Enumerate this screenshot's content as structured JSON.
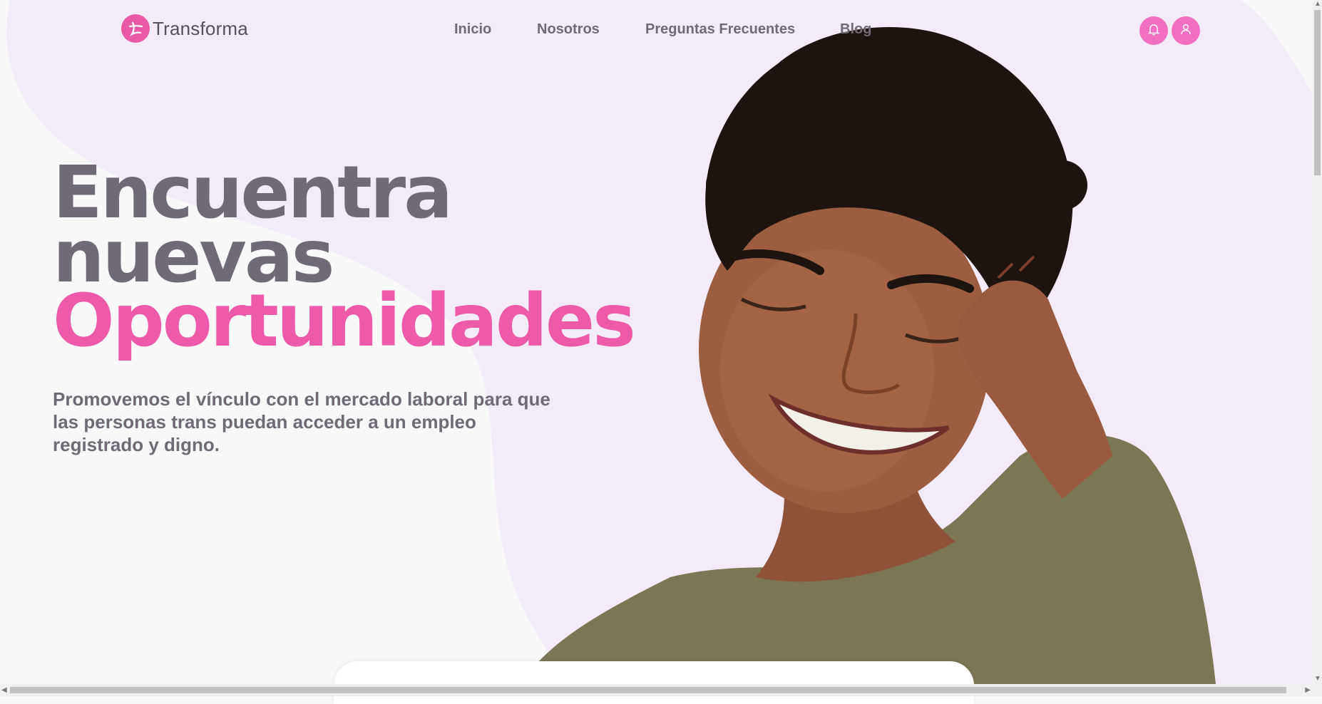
{
  "brand": {
    "name": "Transforma",
    "accent": "#ec5aa9",
    "text_color": "#6f6a76",
    "blob_color": "#f3ebf8"
  },
  "nav": {
    "items": [
      {
        "label": "Inicio"
      },
      {
        "label": "Nosotros"
      },
      {
        "label": "Preguntas Frecuentes"
      },
      {
        "label": "Blog"
      }
    ]
  },
  "actions": {
    "notifications_icon": "bell-icon",
    "account_icon": "user-icon"
  },
  "hero": {
    "line1": "Encuentra",
    "line2": "nuevas",
    "line3": "Oportunidades",
    "subtitle": "Promovemos el vínculo con el mercado laboral para que las personas trans puedan acceder a un empleo registrado y digno."
  }
}
